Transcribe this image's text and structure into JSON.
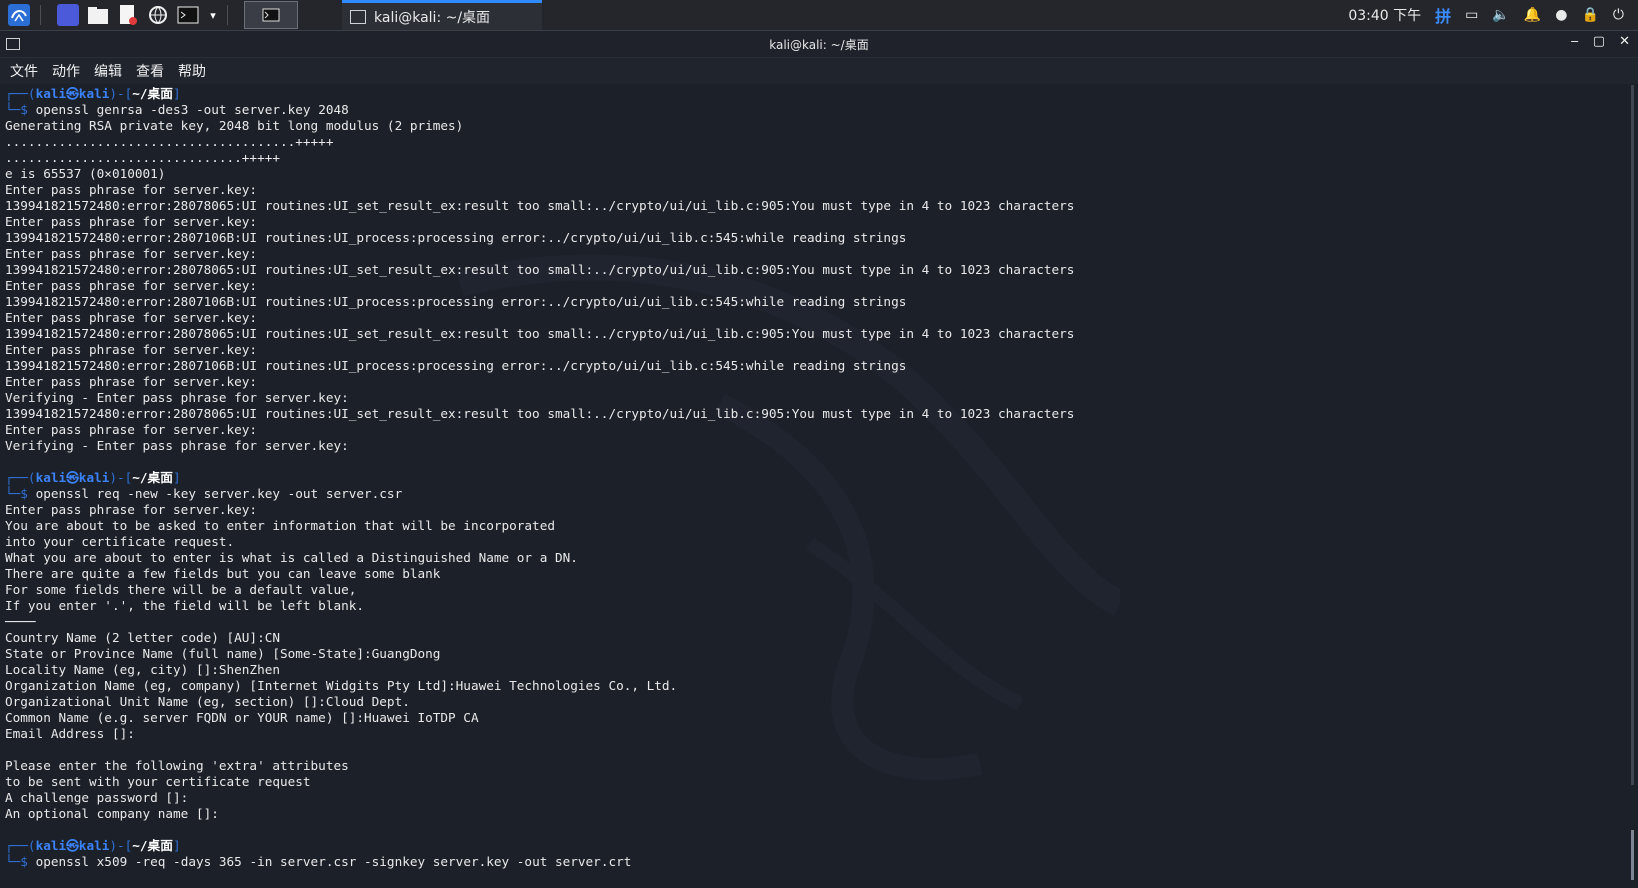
{
  "taskbar": {
    "task_title": "kali@kali: ~/桌面",
    "clock": "03:40 下午",
    "ime": "拼",
    "launcher_icons": [
      "kali-menu-icon",
      "desktop-icon",
      "files-icon",
      "text-editor-icon",
      "browser-icon",
      "terminal-icon",
      "chevron-down-icon"
    ]
  },
  "window": {
    "title": "kali@kali: ~/桌面",
    "controls": {
      "minimize": "‒",
      "maximize": "▢",
      "close": "✕"
    }
  },
  "menu": {
    "file": "文件",
    "action": "动作",
    "edit": "编辑",
    "view": "查看",
    "help": "帮助"
  },
  "terminal": {
    "prompt_user": "kali㉿kali",
    "prompt_path": "~/桌面",
    "prompt_left": "┌──(",
    "prompt_mid": ")-[",
    "prompt_end": "]",
    "prompt_line2": "└─$ ",
    "blocks": [
      {
        "command": "openssl genrsa -des3 -out server.key 2048",
        "output": [
          "Generating RSA private key, 2048 bit long modulus (2 primes)",
          "......................................+++++",
          "...............................+++++",
          "e is 65537 (0×010001)",
          "Enter pass phrase for server.key:",
          "139941821572480:error:28078065:UI routines:UI_set_result_ex:result too small:../crypto/ui/ui_lib.c:905:You must type in 4 to 1023 characters",
          "Enter pass phrase for server.key:",
          "139941821572480:error:2807106B:UI routines:UI_process:processing error:../crypto/ui/ui_lib.c:545:while reading strings",
          "Enter pass phrase for server.key:",
          "139941821572480:error:28078065:UI routines:UI_set_result_ex:result too small:../crypto/ui/ui_lib.c:905:You must type in 4 to 1023 characters",
          "Enter pass phrase for server.key:",
          "139941821572480:error:2807106B:UI routines:UI_process:processing error:../crypto/ui/ui_lib.c:545:while reading strings",
          "Enter pass phrase for server.key:",
          "139941821572480:error:28078065:UI routines:UI_set_result_ex:result too small:../crypto/ui/ui_lib.c:905:You must type in 4 to 1023 characters",
          "Enter pass phrase for server.key:",
          "139941821572480:error:2807106B:UI routines:UI_process:processing error:../crypto/ui/ui_lib.c:545:while reading strings",
          "Enter pass phrase for server.key:",
          "Verifying - Enter pass phrase for server.key:",
          "139941821572480:error:28078065:UI routines:UI_set_result_ex:result too small:../crypto/ui/ui_lib.c:905:You must type in 4 to 1023 characters",
          "Enter pass phrase for server.key:",
          "Verifying - Enter pass phrase for server.key:",
          ""
        ]
      },
      {
        "command": "openssl req -new -key server.key -out server.csr",
        "output": [
          "Enter pass phrase for server.key:",
          "You are about to be asked to enter information that will be incorporated",
          "into your certificate request.",
          "What you are about to enter is what is called a Distinguished Name or a DN.",
          "There are quite a few fields but you can leave some blank",
          "For some fields there will be a default value,",
          "If you enter '.', the field will be left blank.",
          "────",
          "Country Name (2 letter code) [AU]:CN",
          "State or Province Name (full name) [Some-State]:GuangDong",
          "Locality Name (eg, city) []:ShenZhen",
          "Organization Name (eg, company) [Internet Widgits Pty Ltd]:Huawei Technologies Co., Ltd.",
          "Organizational Unit Name (eg, section) []:Cloud Dept.",
          "Common Name (e.g. server FQDN or YOUR name) []:Huawei IoTDP CA",
          "Email Address []:",
          "",
          "Please enter the following 'extra' attributes",
          "to be sent with your certificate request",
          "A challenge password []:",
          "An optional company name []:",
          ""
        ]
      },
      {
        "command": "openssl x509 -req -days 365 -in server.csr -signkey server.key -out server.crt",
        "output": []
      }
    ]
  }
}
